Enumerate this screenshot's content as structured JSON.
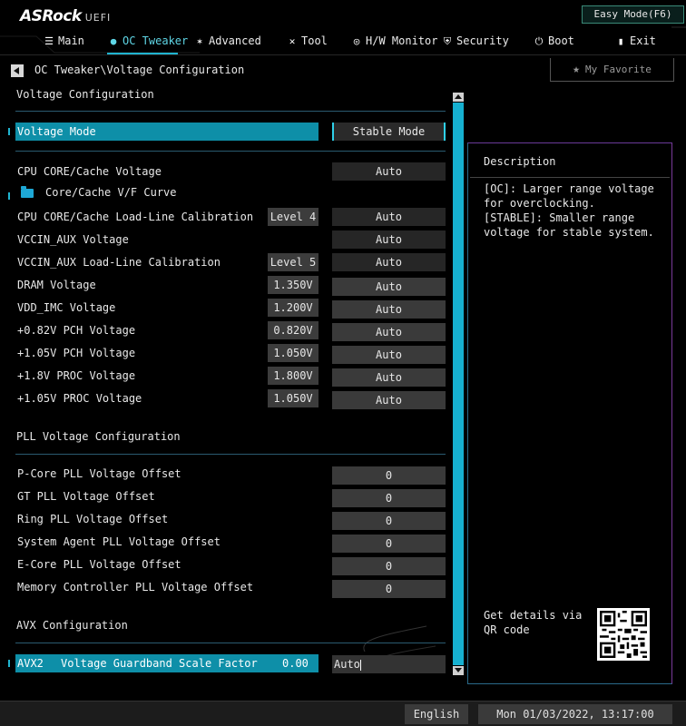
{
  "header": {
    "logo": "ASRock",
    "logo_suffix": "UEFI",
    "easy_mode": "Easy Mode(F6)"
  },
  "nav": [
    {
      "label": "Main",
      "icon": "list-icon"
    },
    {
      "label": "OC Tweaker",
      "icon": "flame-icon",
      "active": true
    },
    {
      "label": "Advanced",
      "icon": "star-icon"
    },
    {
      "label": "Tool",
      "icon": "tools-icon"
    },
    {
      "label": "H/W Monitor",
      "icon": "monitor-icon"
    },
    {
      "label": "Security",
      "icon": "shield-icon"
    },
    {
      "label": "Boot",
      "icon": "power-icon"
    },
    {
      "label": "Exit",
      "icon": "exit-icon"
    }
  ],
  "breadcrumb": "OC Tweaker\\Voltage Configuration",
  "favorite": "My Favorite",
  "sections": {
    "voltage": "Voltage Configuration",
    "pll": "PLL Voltage Configuration",
    "avx": "AVX Configuration"
  },
  "voltage_mode": {
    "label": "Voltage Mode",
    "value": "Stable Mode"
  },
  "voltage_rows": [
    {
      "label": "CPU CORE/Cache Voltage",
      "value": "",
      "option": "Auto"
    },
    {
      "label": "Core/Cache V/F Curve",
      "value": "",
      "option": ""
    },
    {
      "label": "CPU CORE/Cache Load-Line Calibration",
      "value": "Level 4",
      "option": "Auto"
    },
    {
      "label": "VCCIN_AUX Voltage",
      "value": "",
      "option": "Auto"
    },
    {
      "label": "VCCIN_AUX Load-Line Calibration",
      "value": "Level 5",
      "option": "Auto"
    },
    {
      "label": "DRAM Voltage",
      "value": "1.350V",
      "option": "Auto"
    },
    {
      "label": "VDD_IMC Voltage",
      "value": "1.200V",
      "option": "Auto"
    },
    {
      "label": "+0.82V PCH Voltage",
      "value": "0.820V",
      "option": "Auto"
    },
    {
      "label": "+1.05V PCH Voltage",
      "value": "1.050V",
      "option": "Auto"
    },
    {
      "label": "+1.8V PROC Voltage",
      "value": "1.800V",
      "option": "Auto"
    },
    {
      "label": "+1.05V PROC Voltage",
      "value": "1.050V",
      "option": "Auto"
    }
  ],
  "pll_rows": [
    {
      "label": "P-Core PLL Voltage Offset",
      "option": "0"
    },
    {
      "label": "GT PLL Voltage Offset",
      "option": "0"
    },
    {
      "label": "Ring PLL Voltage Offset",
      "option": "0"
    },
    {
      "label": "System Agent PLL Voltage Offset",
      "option": "0"
    },
    {
      "label": "E-Core PLL Voltage Offset",
      "option": "0"
    },
    {
      "label": "Memory Controller PLL Voltage Offset",
      "option": "0"
    }
  ],
  "avx_row": {
    "prefix": "AVX2",
    "label": "Voltage Guardband Scale Factor",
    "value": "0.00",
    "option": "Auto"
  },
  "description": {
    "title": "Description",
    "text": "[OC]: Larger range voltage for overclocking.\n[STABLE]: Smaller range voltage for stable system.",
    "qr_text": "Get details via QR code"
  },
  "footer": {
    "language": "English",
    "datetime": "Mon 01/03/2022, 13:17:00"
  },
  "colors": {
    "accent": "#1fb4d0",
    "highlight": "#0e8fa8",
    "background": "#000000"
  }
}
